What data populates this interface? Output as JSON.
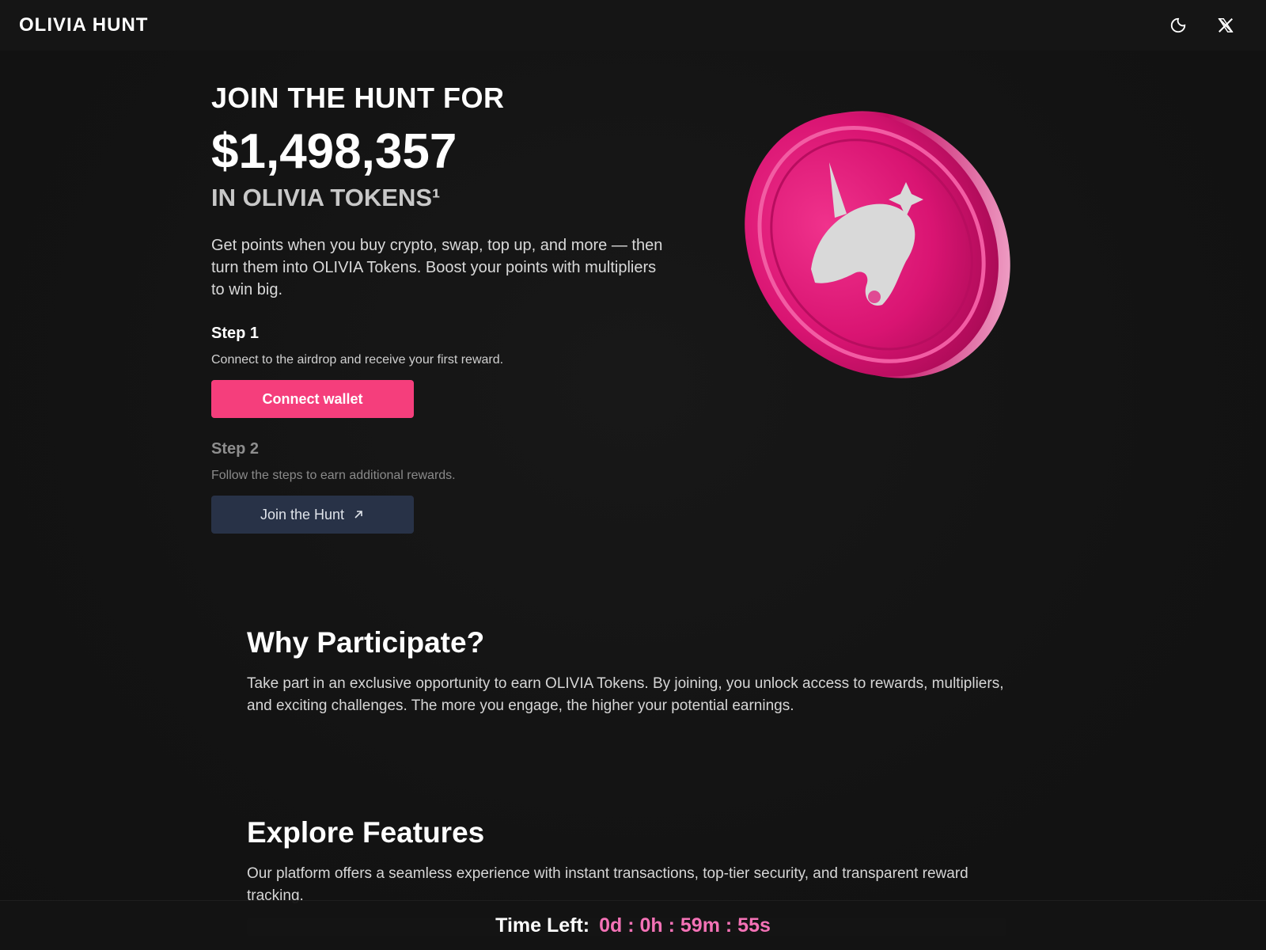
{
  "header": {
    "brand": "OLIVIA HUNT",
    "icons": [
      "theme-toggle-icon",
      "x-twitter-icon"
    ]
  },
  "hero": {
    "kicker": "JOIN THE HUNT FOR",
    "amount": "$1,498,357",
    "subtitle": "IN OLIVIA TOKENS¹",
    "description": "Get points when you buy crypto, swap, top up, and more — then turn them into OLIVIA Tokens. Boost your points with multipliers to win big."
  },
  "steps": [
    {
      "title": "Step 1",
      "description": "Connect to the airdrop and receive your first reward.",
      "button_label": "Connect wallet"
    },
    {
      "title": "Step 2",
      "description": "Follow the steps to earn additional rewards.",
      "button_label": "Join the Hunt"
    }
  ],
  "sections": {
    "why": {
      "title": "Why Participate?",
      "body": "Take part in an exclusive opportunity to earn OLIVIA Tokens. By joining, you unlock access to rewards, multipliers, and exciting challenges. The more you engage, the higher your potential earnings."
    },
    "features": {
      "title": "Explore Features",
      "body": "Our platform offers a seamless experience with instant transactions, top-tier security, and transparent reward tracking."
    }
  },
  "timer": {
    "label": "Time Left:",
    "value": "0d : 0h : 59m : 55s"
  },
  "colors": {
    "accent": "#f53e7c",
    "timer": "#f472b6",
    "secondary_button": "#283247",
    "background": "#141414"
  }
}
